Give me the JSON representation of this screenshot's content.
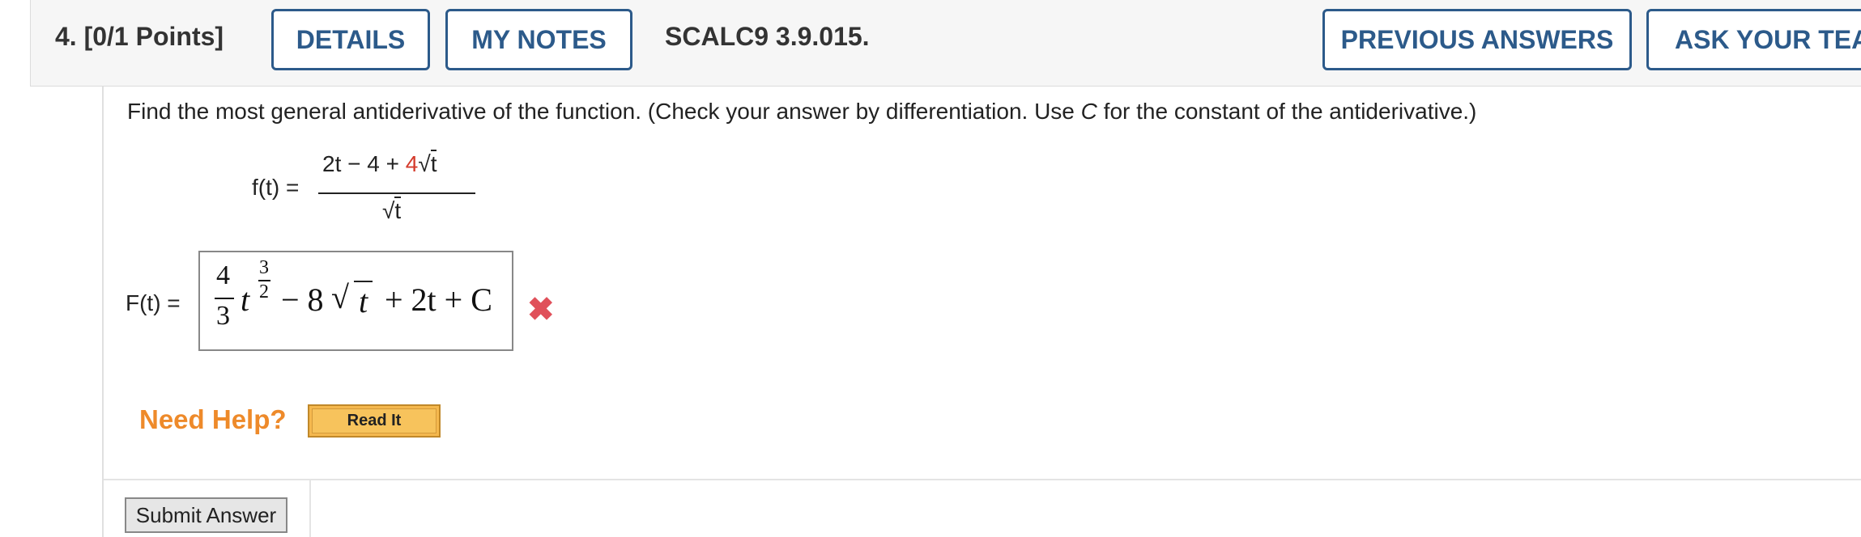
{
  "header": {
    "question_number": "4.",
    "points": "[0/1 Points]",
    "details_label": "DETAILS",
    "my_notes_label": "MY NOTES",
    "question_code": "SCALC9 3.9.015.",
    "previous_answers_label": "PREVIOUS ANSWERS",
    "ask_teacher_label": "ASK YOUR TEACHER"
  },
  "question": {
    "instruction_part1": "Find the most general antiderivative of the function. (Check your answer by differentiation. Use ",
    "instruction_var": "C",
    "instruction_part2": " for the constant of the antiderivative.)",
    "function_label": "f(t) =",
    "numerator_part1": "2t − 4 + ",
    "numerator_red": "4",
    "numerator_radicand": "t",
    "denominator_radicand": "t"
  },
  "answer": {
    "label": "F(t) =",
    "coef_numerator": "4",
    "coef_denominator": "3",
    "variable": "t",
    "exp_numerator": "3",
    "exp_denominator": "2",
    "term2": "− 8",
    "term2_radicand": "t",
    "term3": "+ 2t + C",
    "status_icon": "incorrect-x-icon",
    "status_color": "#e0505a"
  },
  "help": {
    "need_help_label": "Need Help?",
    "read_it_label": "Read It"
  },
  "submit_label": "Submit Answer"
}
